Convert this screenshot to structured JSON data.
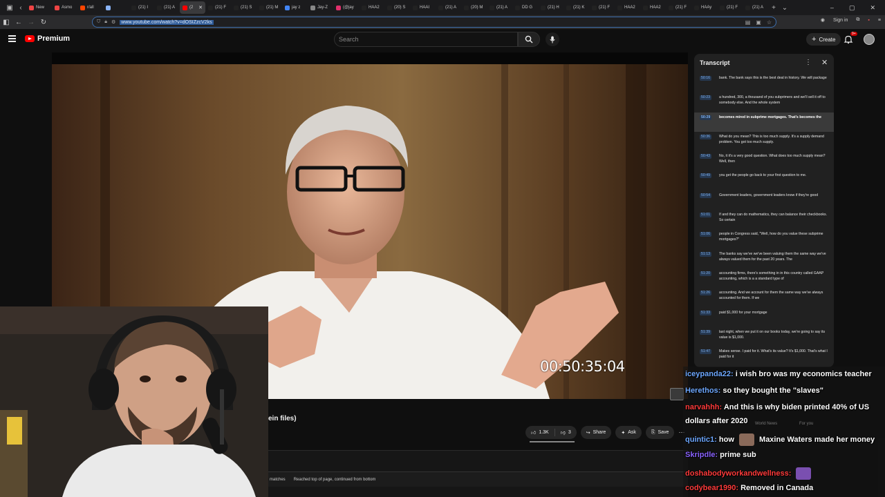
{
  "browser": {
    "tabs": [
      {
        "label": "New",
        "color": "#e44"
      },
      {
        "label": "Asmo",
        "color": "#e44"
      },
      {
        "label": "r/all",
        "color": "#ff4500"
      },
      {
        "label": "",
        "color": "#8ab4f8"
      },
      {
        "label": "(21) I",
        "color": "#222"
      },
      {
        "label": "(21) A",
        "color": "#222"
      },
      {
        "label": "(2",
        "color": "#ff0000",
        "active": true
      },
      {
        "label": "(21) F",
        "color": "#222"
      },
      {
        "label": "(21) S",
        "color": "#222"
      },
      {
        "label": "(21) M",
        "color": "#222"
      },
      {
        "label": "jay z",
        "color": "#4285f4"
      },
      {
        "label": "Jay-Z",
        "color": "#888"
      },
      {
        "label": "(@jay",
        "color": "#e1306c"
      },
      {
        "label": "HAA2",
        "color": "#222"
      },
      {
        "label": "(20) S",
        "color": "#222"
      },
      {
        "label": "HAAI",
        "color": "#222"
      },
      {
        "label": "(21) A",
        "color": "#222"
      },
      {
        "label": "(20) M",
        "color": "#222"
      },
      {
        "label": "(21) A",
        "color": "#222"
      },
      {
        "label": "DD G",
        "color": "#222"
      },
      {
        "label": "(21) H",
        "color": "#222"
      },
      {
        "label": "(21) K",
        "color": "#222"
      },
      {
        "label": "(21) F",
        "color": "#222"
      },
      {
        "label": "HAA2",
        "color": "#222"
      },
      {
        "label": "HAA2",
        "color": "#222"
      },
      {
        "label": "(21) F",
        "color": "#222"
      },
      {
        "label": "HAAy",
        "color": "#222"
      },
      {
        "label": "(21) F",
        "color": "#222"
      },
      {
        "label": "(21) A",
        "color": "#222"
      }
    ],
    "url": "www.youtube.com/watch?v=dOSIZzcV2ks",
    "signin_label": "Sign in"
  },
  "youtube": {
    "logo_text": "Premium",
    "search_placeholder": "Search",
    "create_label": "Create",
    "notif_count": "9+",
    "video_title": "ein files)",
    "likes": "1.3K",
    "dislikes": "3",
    "share_label": "Share",
    "ask_label": "Ask",
    "save_label": "Save",
    "find_matches": "matches",
    "find_status": "Reached top of page, continued from bottom"
  },
  "video": {
    "timecode": "00:50:35:04"
  },
  "transcript": {
    "title": "Transcript",
    "segments": [
      {
        "time": "50:16",
        "text": "bank. The bank says this is the best deal in history. We will package"
      },
      {
        "time": "50:23",
        "text": "a hundred, 300, a thousand of you subprimers and we'll sell it off to somebody else. And the whole system"
      },
      {
        "time": "50:29",
        "text": "becomes mired in subprime mortgages. That's becomes the",
        "active": true
      },
      {
        "time": "50:36",
        "text": "What do you mean? This is too much supply. It's a supply demand problem. You got too much supply."
      },
      {
        "time": "50:43",
        "text": "No, it it's a very good question. What does too much supply mean? Well, then"
      },
      {
        "time": "50:49",
        "text": "you get the people go back to your first question to me."
      },
      {
        "time": "50:54",
        "text": "Government leaders, government leaders know if they're good"
      },
      {
        "time": "51:01",
        "text": "If and they can do mathematics, they can balance their checkbooks. So certain"
      },
      {
        "time": "51:06",
        "text": "people in Congress said, \"Well, how do you value these subprime mortgages?\""
      },
      {
        "time": "51:13",
        "text": "The banks say we've we've been valuing them the same way we've always valued them for the past 20 years. The"
      },
      {
        "time": "51:20",
        "text": "accounting firms, there's something in in this country called GAAP accounting, which is a a standard type of"
      },
      {
        "time": "51:26",
        "text": "accounting. And we account for them the same way we've always accounted for them. If we"
      },
      {
        "time": "51:33",
        "text": "paid $1,000 for your mortgage"
      },
      {
        "time": "51:39",
        "text": "last night, when we put it on our books today, we're going to say its value is $1,000."
      },
      {
        "time": "51:47",
        "text": "Makes sense. I paid for it. What's its value? It's $1,000. That's what I paid for it"
      },
      {
        "time": "51:53",
        "text": "last night. No. The Congress people said that's not really a good answer. You"
      }
    ]
  },
  "chat": {
    "messages": [
      {
        "user": "iceypanda22:",
        "text": "i wish bro was my economics teacher",
        "color": "#6ea8ff"
      },
      {
        "user": "Herethos:",
        "text": "so they bought the \"slaves\"",
        "color": "#6ea8ff"
      },
      {
        "user": "narvahhh:",
        "text": "And this is why biden printed 40% of US",
        "color": "#ff3b3b"
      },
      {
        "user": "",
        "text": "dollars after 2020",
        "color": "#ffffff"
      },
      {
        "user": "quintic1:",
        "text": "how",
        "text2": "Maxine Waters made her money",
        "color": "#6ea8ff"
      },
      {
        "user": "Skripdle:",
        "text": "prime sub",
        "color": "#8a63ff"
      },
      {
        "user": "doshabodyworkandwellness:",
        "text": "",
        "color": "#ff3b3b"
      },
      {
        "user": "codybear1990:",
        "text": "Removed in Canada",
        "color": "#ff3b3b"
      }
    ],
    "ghost": [
      "World News",
      "For you"
    ]
  }
}
